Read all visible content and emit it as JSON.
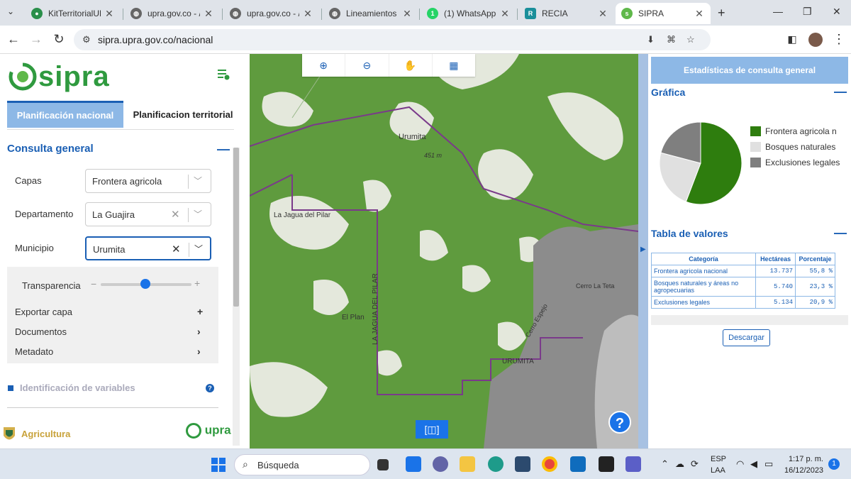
{
  "browser": {
    "tabs": [
      {
        "label": "KitTerritorialUPR",
        "icon": "chrome-icon"
      },
      {
        "label": "upra.gov.co - /K",
        "icon": "globe-icon"
      },
      {
        "label": "upra.gov.co - /K",
        "icon": "globe-icon"
      },
      {
        "label": "Lineamientos se",
        "icon": "globe-icon"
      },
      {
        "label": "(1) WhatsApp",
        "icon": "whatsapp-icon"
      },
      {
        "label": "RECIA",
        "icon": "recia-icon"
      },
      {
        "label": "SIPRA",
        "icon": "sipra-icon"
      }
    ],
    "url": "sipra.upra.gov.co/nacional"
  },
  "sidebar": {
    "logo": "sipra",
    "tabs": [
      "Planificación nacional",
      "Planificacion territorial"
    ],
    "section_title": "Consulta general",
    "fields": [
      {
        "label": "Capas",
        "value": "Frontera agricola"
      },
      {
        "label": "Departamento",
        "value": "La Guajira"
      },
      {
        "label": "Municipio",
        "value": "Urumita"
      }
    ],
    "transparency_label": "Transparencia",
    "transparency_level": 0.45,
    "options": [
      "Exportar capa",
      "Documentos",
      "Metadato"
    ],
    "variables_section": "Identificación de variables",
    "footer_left": "Agricultura",
    "footer_right": "upra"
  },
  "map": {
    "labels": [
      "Urumita",
      "451 m",
      "La Jagua del Pilar",
      "El Plan",
      "LA JAGUA DEL PILAR",
      "URUMITA",
      "Cerro La Teta",
      "Cerro Espejo"
    ]
  },
  "right_panel": {
    "header": "Estadísticas de consulta general",
    "chart_title": "Gráfica",
    "table_title": "Tabla de valores",
    "table_headers": [
      "Categoría",
      "Hectáreas",
      "Porcentaje"
    ],
    "table_rows": [
      [
        "Frontera agricola nacional",
        "13.737",
        "55,8 %"
      ],
      [
        "Bosques naturales y áreas no agropecuarias",
        "5.740",
        "23,3 %"
      ],
      [
        "Exclusiones legales",
        "5.134",
        "20,9 %"
      ]
    ],
    "download": "Descargar"
  },
  "chart_data": {
    "type": "pie",
    "categories": [
      "Frontera agricola n",
      "Bosques naturales",
      "Exclusiones legales"
    ],
    "values": [
      55.8,
      23.3,
      20.9
    ],
    "colors": [
      "#2e7d0e",
      "#e0e0e0",
      "#7f7f7f"
    ]
  },
  "taskbar": {
    "search": "Búsqueda",
    "lang": "ESP",
    "layout": "LAA",
    "time": "1:17 p. m.",
    "date": "16/12/2023",
    "notifications": "1"
  }
}
